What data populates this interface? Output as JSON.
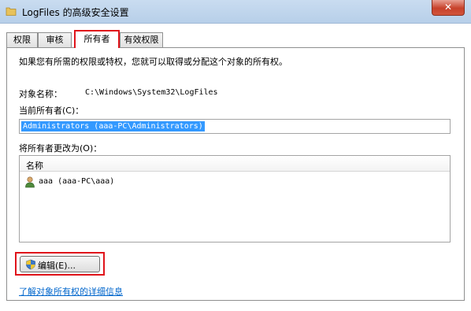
{
  "window": {
    "title": "LogFiles 的高级安全设置",
    "close_label": "✕"
  },
  "tabs": [
    {
      "label": "权限"
    },
    {
      "label": "审核"
    },
    {
      "label": "所有者",
      "active": true
    },
    {
      "label": "有效权限"
    }
  ],
  "owner_tab": {
    "intro_text": "如果您有所需的权限或特权，您就可以取得或分配这个对象的所有权。",
    "object_name_label": "对象名称：",
    "object_name_value": "C:\\Windows\\System32\\LogFiles",
    "current_owner_label": "当前所有者(C)：",
    "current_owner_value": "Administrators (aaa-PC\\Administrators)",
    "change_owner_label": "将所有者更改为(O)：",
    "list": {
      "column_name": "名称",
      "items": [
        {
          "name": "aaa (aaa-PC\\aaa)",
          "icon": "user-icon"
        }
      ]
    },
    "edit_button_label": "编辑(E)...",
    "info_link": "了解对象所有权的详细信息"
  },
  "colors": {
    "highlight_box": "#e0141b",
    "selection": "#3399ff",
    "link": "#0066cc"
  }
}
